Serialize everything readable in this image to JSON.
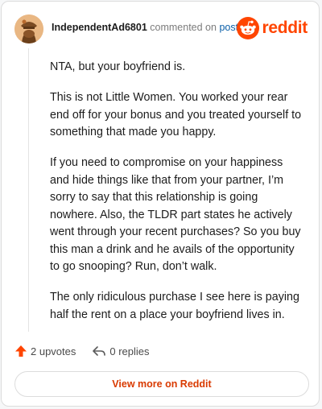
{
  "comment": {
    "username": "IndependentAd6801",
    "commented_on": "commented on",
    "post_link": "post",
    "paragraphs": [
      "NTA, but your boyfriend is.",
      "This is not Little Women. You worked your rear end off for your bonus and you treated yourself to something that made you happy.",
      "If you need to compromise on your happiness and hide things like that from your partner, I’m sorry to say that this relationship is going nowhere. Also, the TLDR part states he actively went through your recent purchases? So you buy this man a drink and he avails of the opportunity to go snooping? Run, don’t walk.",
      "The only ridiculous purchase I see here is paying half the rent on a place your boyfriend lives in."
    ]
  },
  "brand": {
    "name": "reddit",
    "color": "#ff4500",
    "icon": "reddit-snoo-icon"
  },
  "actions": {
    "upvotes_label": "2 upvotes",
    "replies_label": "0 replies",
    "upvote_icon": "upvote-arrow-icon",
    "reply_icon": "reply-arrow-icon",
    "upvote_color": "#ff4500"
  },
  "footer": {
    "view_more_label": "View more on Reddit",
    "accent_color": "#d93a00"
  }
}
